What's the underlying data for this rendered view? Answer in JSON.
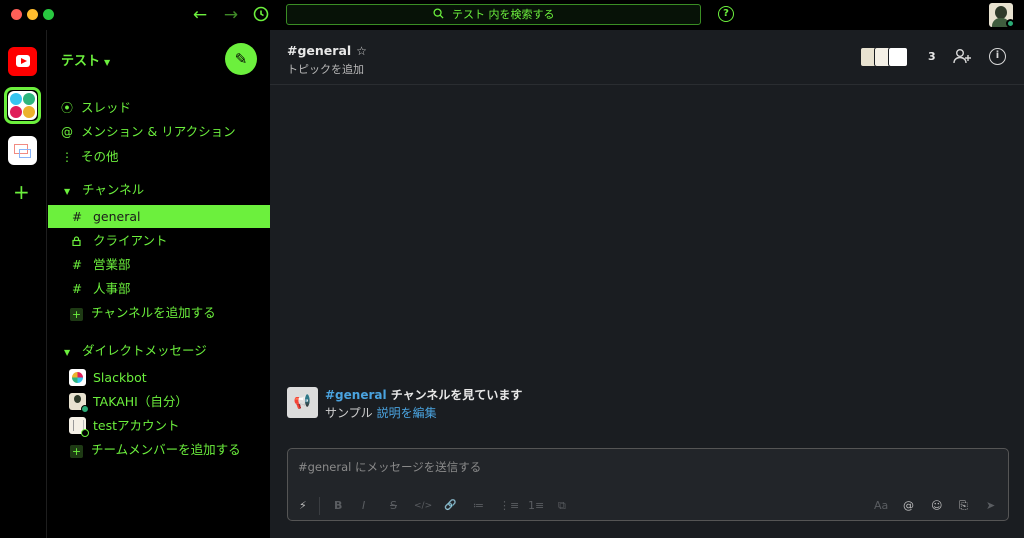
{
  "titlebar": {
    "search_placeholder": "テスト 内を検索する",
    "icons": {
      "back": "arrow-left-icon",
      "forward": "arrow-right-icon",
      "history": "clock-icon",
      "help": "question-circle-icon"
    }
  },
  "rail": {
    "workspaces": [
      "youtube-workspace",
      "test-workspace",
      "third-workspace"
    ],
    "add_label": "+"
  },
  "sidebar": {
    "workspace_name": "テスト",
    "nav": [
      {
        "icon": "threads-icon",
        "label": "スレッド"
      },
      {
        "icon": "at-icon",
        "label": "メンション & リアクション"
      },
      {
        "icon": "more-vertical-icon",
        "label": "その他"
      }
    ],
    "channels_header": "チャンネル",
    "channels": [
      {
        "prefix": "#",
        "label": "general",
        "active": true
      },
      {
        "prefix": "🔒",
        "label": "クライアント",
        "active": false
      },
      {
        "prefix": "#",
        "label": "営業部",
        "active": false
      },
      {
        "prefix": "#",
        "label": "人事部",
        "active": false
      }
    ],
    "add_channel": "チャンネルを追加する",
    "dm_header": "ダイレクトメッセージ",
    "dms": [
      {
        "label": "Slackbot",
        "avatar": "slackbot-avatar",
        "presence": "none"
      },
      {
        "label": "TAKAHI（自分）",
        "avatar": "user-avatar",
        "presence": "online"
      },
      {
        "label": "testアカウント",
        "avatar": "test-avatar",
        "presence": "offline"
      }
    ],
    "add_member": "チームメンバーを追加する"
  },
  "header": {
    "channel_name": "#general",
    "topic": "トピックを追加",
    "member_count": "3"
  },
  "intro": {
    "channel_link": "#general",
    "line1_suffix": " チャンネルを見ています",
    "description": "サンプル",
    "edit_link": "説明を編集"
  },
  "composer": {
    "placeholder": "#general にメッセージを送信する",
    "tools": [
      "⚡",
      "B",
      "I",
      "S",
      "</>",
      "🔗",
      "≔",
      "⋮≡",
      "1≡",
      "⧉"
    ],
    "right_tools": [
      "Aa",
      "@",
      "☺",
      "⎘",
      "➤"
    ]
  },
  "colors": {
    "accent": "#6cf03d",
    "main_bg": "#1a1d21",
    "link": "#4aa3df"
  }
}
